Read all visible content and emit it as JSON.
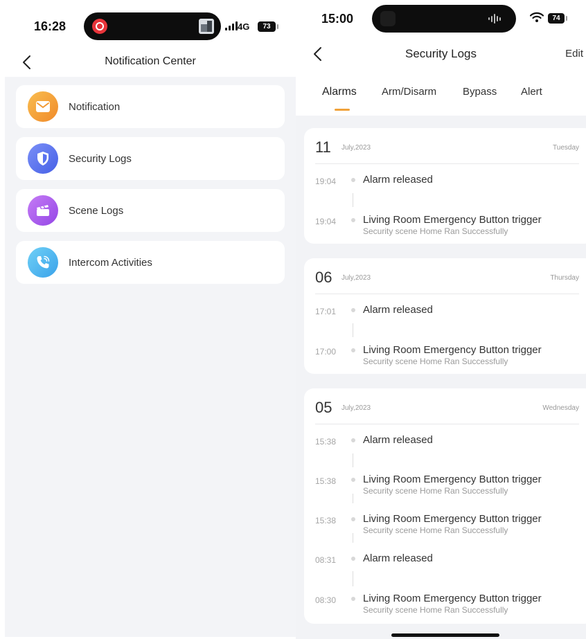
{
  "left_phone": {
    "status_bar": {
      "time": "16:28",
      "network": "4G",
      "battery": "73"
    },
    "nav": {
      "title": "Notification Center"
    },
    "menu": [
      {
        "label": "Notification",
        "icon": "mail-icon",
        "color": "#f4a53c"
      },
      {
        "label": "Security Logs",
        "icon": "shield-icon",
        "color": "#5a72f0"
      },
      {
        "label": "Scene Logs",
        "icon": "clapperboard-icon",
        "color": "#b060ee"
      },
      {
        "label": "Intercom Activities",
        "icon": "phone-icon",
        "color": "#4bb6f0"
      }
    ]
  },
  "right_phone": {
    "status_bar": {
      "time": "15:00",
      "battery": "74"
    },
    "nav": {
      "title": "Security Logs",
      "edit": "Edit"
    },
    "tabs": [
      {
        "label": "Alarms",
        "active": true
      },
      {
        "label": "Arm/Disarm",
        "active": false
      },
      {
        "label": "Bypass",
        "active": false
      },
      {
        "label": "Alert",
        "active": false
      }
    ],
    "accent_color": "#f0a23a",
    "groups": [
      {
        "day": "11",
        "month": "July,2023",
        "weekday": "Tuesday",
        "entries": [
          {
            "time": "19:04",
            "title": "Alarm released",
            "subtitle": ""
          },
          {
            "time": "19:04",
            "title": "Living Room Emergency Button trigger",
            "subtitle": "Security scene Home Ran Successfully"
          }
        ]
      },
      {
        "day": "06",
        "month": "July,2023",
        "weekday": "Thursday",
        "entries": [
          {
            "time": "17:01",
            "title": "Alarm released",
            "subtitle": ""
          },
          {
            "time": "17:00",
            "title": "Living Room Emergency Button trigger",
            "subtitle": "Security scene Home Ran Successfully"
          }
        ]
      },
      {
        "day": "05",
        "month": "July,2023",
        "weekday": "Wednesday",
        "entries": [
          {
            "time": "15:38",
            "title": "Alarm released",
            "subtitle": ""
          },
          {
            "time": "15:38",
            "title": "Living Room Emergency Button trigger",
            "subtitle": "Security scene Home Ran Successfully"
          },
          {
            "time": "15:38",
            "title": "Living Room Emergency Button trigger",
            "subtitle": "Security scene Home Ran Successfully"
          },
          {
            "time": "08:31",
            "title": "Alarm released",
            "subtitle": ""
          },
          {
            "time": "08:30",
            "title": "Living Room Emergency Button trigger",
            "subtitle": "Security scene Home Ran Successfully"
          }
        ]
      }
    ]
  }
}
